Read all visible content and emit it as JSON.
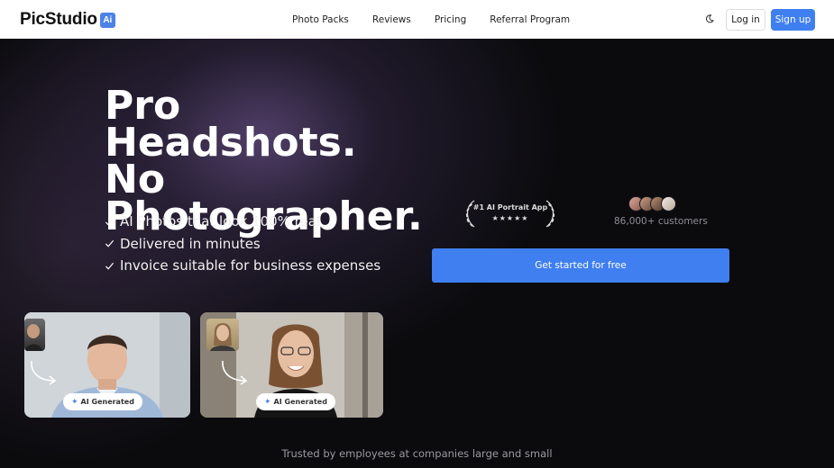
{
  "header": {
    "logo_text": "PicStudio",
    "logo_badge": "Ai",
    "nav": [
      "Photo Packs",
      "Reviews",
      "Pricing",
      "Referral Program"
    ],
    "login_label": "Log in",
    "signup_label": "Sign up"
  },
  "hero": {
    "headline_1": "Pro Headshots.",
    "headline_2": "No",
    "headline_3": "Photographer.",
    "features": [
      "AI Photos that look 100% real",
      "Delivered in minutes",
      "Invoice suitable for business expenses"
    ],
    "badge_text": "#1 AI Portrait App",
    "badge_stars": "★★★★★",
    "customers": "86,000+ customers",
    "cta_label": "Get started for free",
    "ai_tag_label": "AI Generated",
    "trusted": "Trusted by employees at companies large and small"
  },
  "colors": {
    "accent": "#3f7ff0",
    "background": "#0b0b0e"
  }
}
